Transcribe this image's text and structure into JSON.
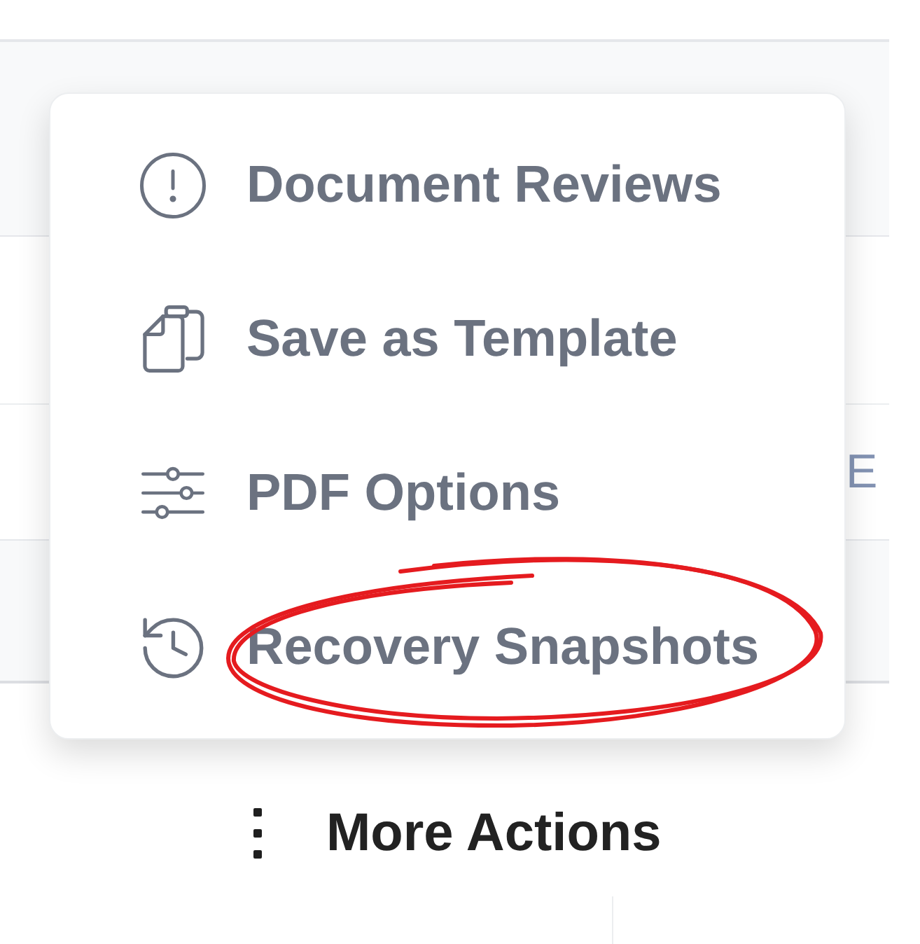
{
  "menu": {
    "items": [
      {
        "label": "Document Reviews",
        "highlighted": false
      },
      {
        "label": "Save as Template",
        "highlighted": false
      },
      {
        "label": "PDF Options",
        "highlighted": false
      },
      {
        "label": "Recovery Snapshots",
        "highlighted": true
      }
    ]
  },
  "background_row": {
    "cut_text": "E"
  },
  "more_actions": {
    "label": "More Actions"
  }
}
